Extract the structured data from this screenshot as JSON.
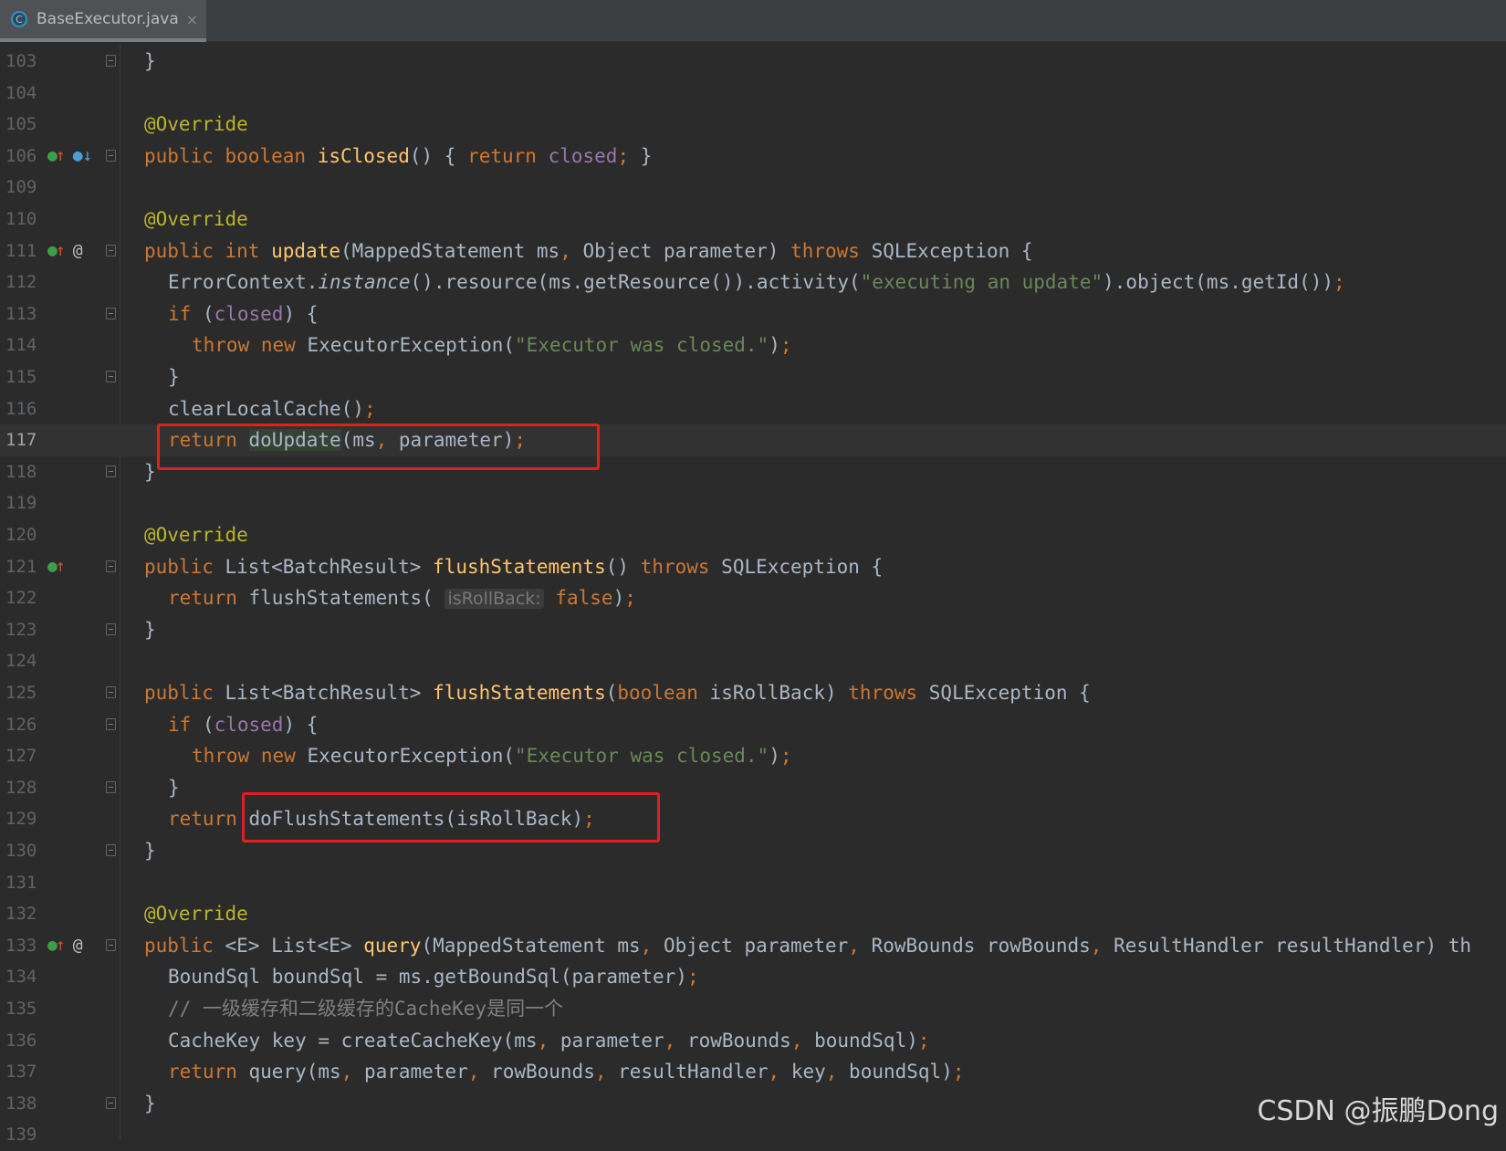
{
  "tab": {
    "title": "BaseExecutor.java",
    "icon_letter": "C",
    "close": "×"
  },
  "watermark": "CSDN @振鹏Dong",
  "lines": [
    {
      "n": "103",
      "t": "}"
    },
    {
      "n": "104",
      "t": ""
    },
    {
      "n": "105",
      "t": "@Override"
    },
    {
      "n": "106",
      "t": "public boolean isClosed() { return closed; }"
    },
    {
      "n": "109",
      "t": ""
    },
    {
      "n": "110",
      "t": "@Override"
    },
    {
      "n": "111",
      "t": "public int update(MappedStatement ms, Object parameter) throws SQLException {"
    },
    {
      "n": "112",
      "t": "ErrorContext.instance().resource(ms.getResource()).activity(\"executing an update\").object(ms.getId());"
    },
    {
      "n": "113",
      "t": "if (closed) {"
    },
    {
      "n": "114",
      "t": "throw new ExecutorException(\"Executor was closed.\");"
    },
    {
      "n": "115",
      "t": "}"
    },
    {
      "n": "116",
      "t": "clearLocalCache();"
    },
    {
      "n": "117",
      "t": "return doUpdate(ms, parameter);"
    },
    {
      "n": "118",
      "t": "}"
    },
    {
      "n": "119",
      "t": ""
    },
    {
      "n": "120",
      "t": "@Override"
    },
    {
      "n": "121",
      "t": "public List<BatchResult> flushStatements() throws SQLException {"
    },
    {
      "n": "122",
      "t": "return flushStatements( isRollBack: false);"
    },
    {
      "n": "123",
      "t": "}"
    },
    {
      "n": "124",
      "t": ""
    },
    {
      "n": "125",
      "t": "public List<BatchResult> flushStatements(boolean isRollBack) throws SQLException {"
    },
    {
      "n": "126",
      "t": "if (closed) {"
    },
    {
      "n": "127",
      "t": "throw new ExecutorException(\"Executor was closed.\");"
    },
    {
      "n": "128",
      "t": "}"
    },
    {
      "n": "129",
      "t": "return doFlushStatements(isRollBack);"
    },
    {
      "n": "130",
      "t": "}"
    },
    {
      "n": "131",
      "t": ""
    },
    {
      "n": "132",
      "t": "@Override"
    },
    {
      "n": "133",
      "t": "public <E> List<E> query(MappedStatement ms, Object parameter, RowBounds rowBounds, ResultHandler resultHandler) th"
    },
    {
      "n": "134",
      "t": "BoundSql boundSql = ms.getBoundSql(parameter);"
    },
    {
      "n": "135",
      "t": "// 一级缓存和二级缓存的CacheKey是同一个"
    },
    {
      "n": "136",
      "t": "CacheKey key = createCacheKey(ms, parameter, rowBounds, boundSql);"
    },
    {
      "n": "137",
      "t": "return query(ms, parameter, rowBounds, resultHandler, key, boundSql);"
    },
    {
      "n": "138",
      "t": "}"
    },
    {
      "n": "139",
      "t": ""
    }
  ],
  "colors": {
    "keyword": "#cc7832",
    "annotation": "#bbb529",
    "method": "#ffc66d",
    "string": "#6a8759",
    "field": "#9876aa",
    "highlight_box": "#e02020"
  }
}
